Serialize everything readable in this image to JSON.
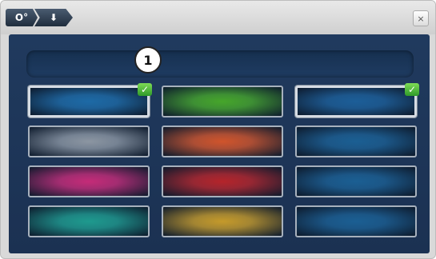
{
  "topbar": {
    "breadcrumb": [
      {
        "label": "O°",
        "icon": "settings-icon"
      },
      {
        "label": "⬇",
        "icon": "download-icon"
      }
    ],
    "close_label": "×"
  },
  "preview": {
    "marker_label": "1"
  },
  "swatches": [
    {
      "name": "blue",
      "color": "#1d6aa6",
      "selected": true
    },
    {
      "name": "green",
      "color": "#46a62a",
      "selected": false
    },
    {
      "name": "blue",
      "color": "#1c5e98",
      "selected": true
    },
    {
      "name": "gray",
      "color": "#8c96a2",
      "selected": false
    },
    {
      "name": "orange",
      "color": "#d0542b",
      "selected": false
    },
    {
      "name": "blue",
      "color": "#1b5f93",
      "selected": false
    },
    {
      "name": "magenta",
      "color": "#c52b78",
      "selected": false
    },
    {
      "name": "red",
      "color": "#b5242a",
      "selected": false
    },
    {
      "name": "blue",
      "color": "#1b5f93",
      "selected": false
    },
    {
      "name": "teal",
      "color": "#1e9a8e",
      "selected": false
    },
    {
      "name": "yellow-orange",
      "color": "#c59a2a",
      "selected": false
    },
    {
      "name": "blue",
      "color": "#1b5f93",
      "selected": false
    }
  ],
  "check_icon": "✓"
}
